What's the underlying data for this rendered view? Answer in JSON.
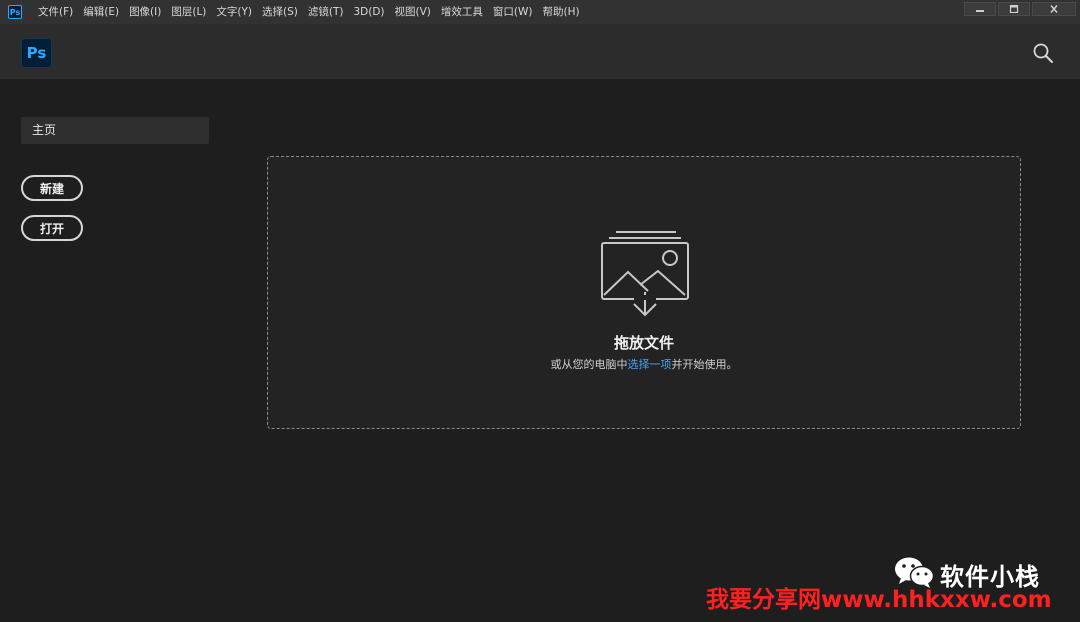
{
  "menubar": {
    "app_icon": "Ps",
    "items": [
      {
        "label": "文件(F)"
      },
      {
        "label": "编辑(E)"
      },
      {
        "label": "图像(I)"
      },
      {
        "label": "图层(L)"
      },
      {
        "label": "文字(Y)"
      },
      {
        "label": "选择(S)"
      },
      {
        "label": "滤镜(T)"
      },
      {
        "label": "3D(D)"
      },
      {
        "label": "视图(V)"
      },
      {
        "label": "增效工具"
      },
      {
        "label": "窗口(W)"
      },
      {
        "label": "帮助(H)"
      }
    ],
    "window_controls": [
      "minimize-icon",
      "maximize-icon",
      "close-icon"
    ]
  },
  "header": {
    "logo_text": "Ps",
    "search_icon": "search-icon"
  },
  "sidebar": {
    "home_label": "主页",
    "new_label": "新建",
    "open_label": "打开"
  },
  "dropzone": {
    "icon": "image-stack-download-icon",
    "title": "拖放文件",
    "subtitle_prefix": "或从您的电脑中",
    "subtitle_link": "选择一项",
    "subtitle_suffix": "并开始使用。"
  },
  "watermark": {
    "icon": "wechat-icon",
    "account": "软件小栈",
    "site": "我要分享网www.hhkxxw.com"
  },
  "colors": {
    "background": "#1e1e1e",
    "header": "#2c2c2c",
    "menubar": "#323232",
    "accent_link": "#4ba3f5",
    "ps_blue": "#31a8ff",
    "ps_navy": "#001e36",
    "watermark_red": "#ff2020"
  }
}
